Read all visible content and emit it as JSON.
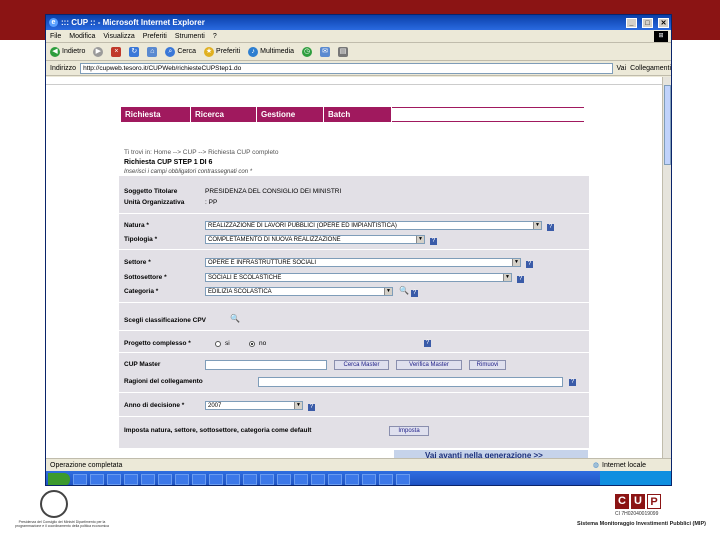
{
  "window": {
    "title": "::: CUP :: - Microsoft Internet Explorer",
    "min": "_",
    "max": "□",
    "close": "✕",
    "winlogo": "⊞"
  },
  "menubar": [
    "File",
    "Modifica",
    "Visualizza",
    "Preferiti",
    "Strumenti",
    "?"
  ],
  "toolbar": {
    "back": "Indietro",
    "search": "Cerca",
    "favorites": "Preferiti",
    "multimedia": "Multimedia"
  },
  "addressbar": {
    "label": "Indirizzo",
    "url": "http://cupweb.tesoro.it/CUPWeb/richiesteCUPStep1.do",
    "go": "Vai",
    "links": "Collegamenti"
  },
  "nav": [
    "Richiesta",
    "Ricerca",
    "Gestione",
    "Batch"
  ],
  "breadcrumb": "Ti trovi in: Home --> CUP --> Richiesta CUP completo",
  "step_title": "Richiesta CUP    STEP 1 DI 6",
  "subtitle": "Inserisci i campi obbligatori contrassegnati con *",
  "form": {
    "soggetto_label": "Soggetto Titolare",
    "soggetto_value": "PRESIDENZA DEL CONSIGLIO DEI MINISTRI",
    "unita_label": "Unità Organizzativa",
    "unita_value": ": PP",
    "natura_label": "Natura *",
    "natura_value": "REALIZZAZIONE DI LAVORI PUBBLICI (OPERE ED IMPIANTISTICA)",
    "tipologia_label": "Tipologia *",
    "tipologia_value": "COMPLETAMENTO DI NUOVA REALIZZAZIONE",
    "settore_label": "Settore *",
    "settore_value": "OPERE E INFRASTRUTTURE SOCIALI",
    "sottosettore_label": "Sottosettore *",
    "sottosettore_value": "SOCIALI E SCOLASTICHE",
    "categoria_label": "Categoria *",
    "categoria_value": "EDILIZIA SCOLASTICA",
    "cpv_label": "Scegli classificazione CPV",
    "complesso_label": "Progetto complesso *",
    "radio_si": "si",
    "radio_no": "no",
    "master_label": "CUP Master",
    "cerca_master": "Cerca Master",
    "verifica_master": "Verifica Master",
    "rimuovi": "Rimuovi",
    "ragioni_label": "Ragioni del collegamento",
    "anno_label": "Anno di decisione *",
    "anno_value": "2007",
    "imposta_text": "Imposta natura, settore, sottosettore, categoria come default",
    "imposta_button": "Imposta",
    "help": "?"
  },
  "next_button": "Vai avanti nella generazione >>",
  "statusbar": {
    "left": "Operazione completata",
    "zone": "Internet locale"
  },
  "footer": {
    "left_caption": "Presidenza del Consiglio dei Ministri Dipartimento per la programmazione e il coordinamento della politica economica",
    "cup_code": "CI 7H02040019099",
    "cup_caption": "Sistema Monitoraggio Investimenti Pubblici (MIP)",
    "cup_letters": [
      "C",
      "U",
      "P"
    ]
  },
  "colors": {
    "slide_band": "#8b1414",
    "nav_bg": "#a0195e",
    "form_bg": "#e2e0e6"
  }
}
